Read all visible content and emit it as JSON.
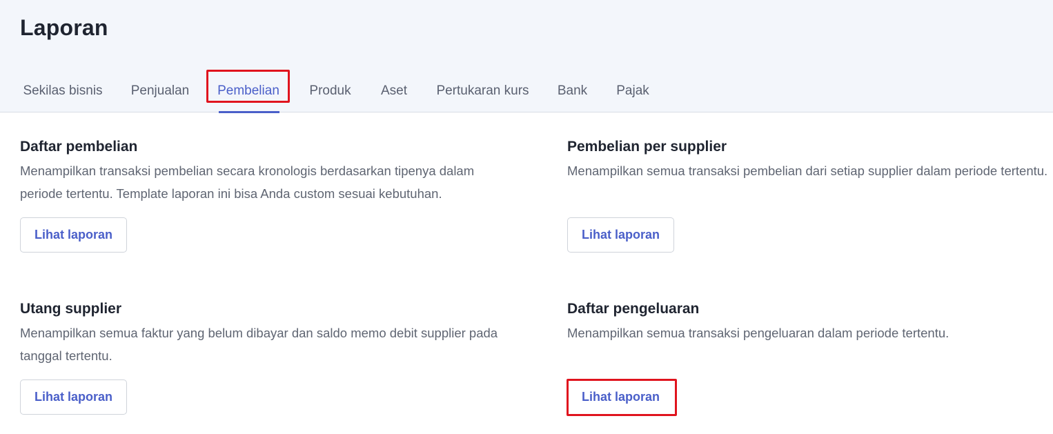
{
  "page": {
    "title": "Laporan"
  },
  "tabs": [
    {
      "label": "Sekilas bisnis",
      "active": false
    },
    {
      "label": "Penjualan",
      "active": false
    },
    {
      "label": "Pembelian",
      "active": true
    },
    {
      "label": "Produk",
      "active": false
    },
    {
      "label": "Aset",
      "active": false
    },
    {
      "label": "Pertukaran kurs",
      "active": false
    },
    {
      "label": "Bank",
      "active": false
    },
    {
      "label": "Pajak",
      "active": false
    }
  ],
  "cards": [
    {
      "title": "Daftar pembelian",
      "description": "Menampilkan transaksi pembelian secara kronologis berdasarkan tipenya dalam periode tertentu. Template laporan ini bisa Anda custom sesuai kebutuhan.",
      "button_label": "Lihat laporan"
    },
    {
      "title": "Pembelian per supplier",
      "description": "Menampilkan semua transaksi pembelian dari setiap supplier dalam periode tertentu.",
      "button_label": "Lihat laporan"
    },
    {
      "title": "Utang supplier",
      "description": "Menampilkan semua faktur yang belum dibayar dan saldo memo debit supplier pada tanggal tertentu.",
      "button_label": "Lihat laporan"
    },
    {
      "title": "Daftar pengeluaran",
      "description": "Menampilkan semua transaksi pengeluaran dalam periode tertentu.",
      "button_label": "Lihat laporan"
    }
  ],
  "colors": {
    "accent": "#4a5fc9",
    "highlight": "#e0141e",
    "header_bg": "#f3f6fb"
  }
}
